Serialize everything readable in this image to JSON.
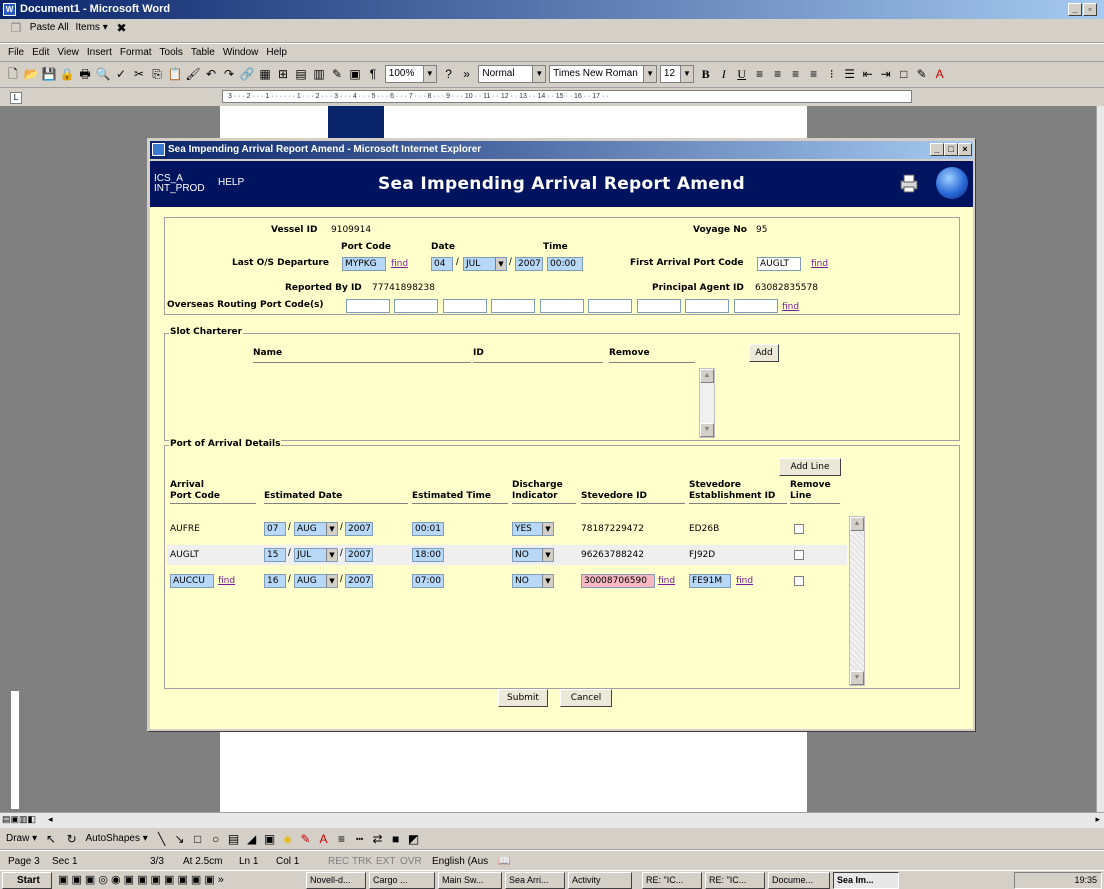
{
  "word": {
    "title": "Document1 - Microsoft Word",
    "clipboard": {
      "paste_all": "Paste All",
      "items": "Items ▾"
    },
    "menu": [
      "File",
      "Edit",
      "View",
      "Insert",
      "Format",
      "Tools",
      "Table",
      "Window",
      "Help"
    ],
    "toolbar": {
      "zoom": "100%",
      "style": "Normal",
      "font": "Times New Roman",
      "size": "12"
    },
    "ruler_text": "3 · · · 2 · · · 1 · · · · · · 1 · · · 2 · · · 3 · · · 4 · · · 5 · · · 6 · · · 7 · · · 8 · · · 9 · · · 10 · · 11 · · 12 · · 13 · · 14 · · 15 · · 16 · · 17 · ·",
    "draw_bar": {
      "draw": "Draw ▾",
      "autoshapes": "AutoShapes ▾"
    },
    "status": {
      "page": "Page 3",
      "sec": "Sec 1",
      "pages": "3/3",
      "at": "At 2.5cm",
      "ln": "Ln 1",
      "col": "Col 1",
      "rec": "REC",
      "trk": "TRK",
      "ext": "EXT",
      "ovr": "OVR",
      "lang": "English (Aus"
    }
  },
  "taskbar": {
    "start": "Start",
    "tasks": [
      "Novell-d...",
      "Cargo ...",
      "Main Sw...",
      "Sea Arri...",
      "Activity",
      "RE: \"IC...",
      "RE: \"IC...",
      "Docume...",
      "Sea Im..."
    ],
    "clock": "19:35"
  },
  "ie": {
    "title": "Sea Impending Arrival Report Amend - Microsoft Internet Explorer"
  },
  "app": {
    "system_line1": "ICS_A",
    "system_line2": "INT_PROD",
    "help": "HELP",
    "page_title": "Sea Impending Arrival Report Amend"
  },
  "header_panel": {
    "vessel_id_label": "Vessel ID",
    "vessel_id": "9109914",
    "voyage_no_label": "Voyage No",
    "voyage_no": "95",
    "port_code_label": "Port Code",
    "date_label": "Date",
    "time_label": "Time",
    "last_departure_label": "Last O/S Departure",
    "last_port_code": "MYPKG",
    "find": "find",
    "dep_day": "04",
    "dep_month": "JUL",
    "dep_year": "2007",
    "dep_time": "00:00",
    "first_arrival_label": "First Arrival Port Code",
    "first_arrival_port": "AUGLT",
    "reported_by_label": "Reported By ID",
    "reported_by": "77741898238",
    "principal_agent_label": "Principal Agent ID",
    "principal_agent": "63082835578",
    "routing_label": "Overseas Routing Port Code(s)"
  },
  "slot_charterer": {
    "title": "Slot Charterer",
    "col_name": "Name",
    "col_id": "ID",
    "col_remove": "Remove",
    "add": "Add"
  },
  "arrival": {
    "title": "Port of Arrival Details",
    "add_line": "Add Line",
    "col_port_1": "Arrival",
    "col_port_2": "Port Code",
    "col_date": "Estimated Date",
    "col_time": "Estimated Time",
    "col_discharge_1": "Discharge",
    "col_discharge_2": "Indicator",
    "col_stevedore": "Stevedore ID",
    "col_est_1": "Stevedore",
    "col_est_2": "Establishment ID",
    "col_remove_1": "Remove",
    "col_remove_2": "Line",
    "rows": [
      {
        "port": "AUFRE",
        "day": "07",
        "month": "AUG",
        "year": "2007",
        "time": "00:01",
        "discharge": "YES",
        "stevedore": "78187229472",
        "establishment": "ED26B"
      },
      {
        "port": "AUGLT",
        "day": "15",
        "month": "JUL",
        "year": "2007",
        "time": "18:00",
        "discharge": "NO",
        "stevedore": "96263788242",
        "establishment": "FJ92D"
      },
      {
        "port": "AUCCU",
        "day": "16",
        "month": "AUG",
        "year": "2007",
        "time": "07:00",
        "discharge": "NO",
        "stevedore": "30008706590",
        "establishment": "FE91M"
      }
    ]
  },
  "actions": {
    "submit": "Submit",
    "cancel": "Cancel"
  }
}
